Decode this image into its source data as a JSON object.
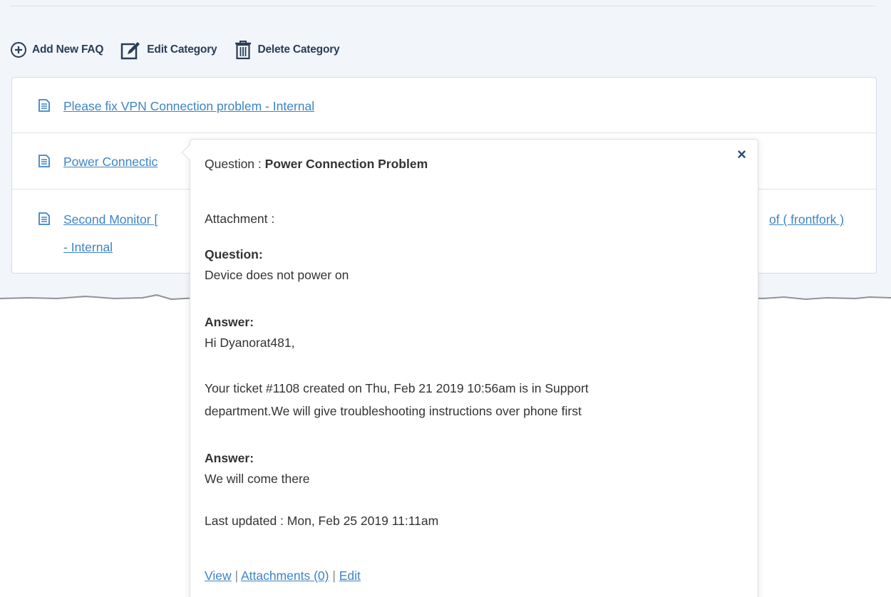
{
  "toolbar": {
    "add_faq": "Add New FAQ",
    "edit_category": "Edit Category",
    "delete_category": "Delete Category"
  },
  "faq_list": {
    "rows": [
      {
        "title": "Please fix VPN Connection problem - Internal"
      },
      {
        "title": "Power Connectic"
      },
      {
        "title_line1": "Second Monitor [",
        "title_line1_tail": "of ( frontfork )",
        "title_line2": "- Internal"
      }
    ]
  },
  "popover": {
    "close": "×",
    "question_label": "Question : ",
    "question_value": "Power Connection Problem",
    "attachment_label": "Attachment :",
    "q_heading": "Question:",
    "q_body": "Device does not power on",
    "a1_heading": "Answer:",
    "a1_line1": "Hi Dyanorat481,",
    "a1_line2": "Your ticket #1108 created on Thu, Feb 21 2019 10:56am is in Support",
    "a1_line3": "department.We will give troubleshooting instructions over phone first",
    "a2_heading": "Answer:",
    "a2_body": "We will come there",
    "last_updated": "Last updated : Mon, Feb 25 2019 11:11am",
    "links": {
      "view": "View",
      "attachments": "Attachments (0)",
      "edit": "Edit",
      "separator": " | "
    }
  },
  "colors": {
    "link": "#3d84c6",
    "toolbar_text": "#2a3d57",
    "background_top": "#f2f6fa"
  }
}
